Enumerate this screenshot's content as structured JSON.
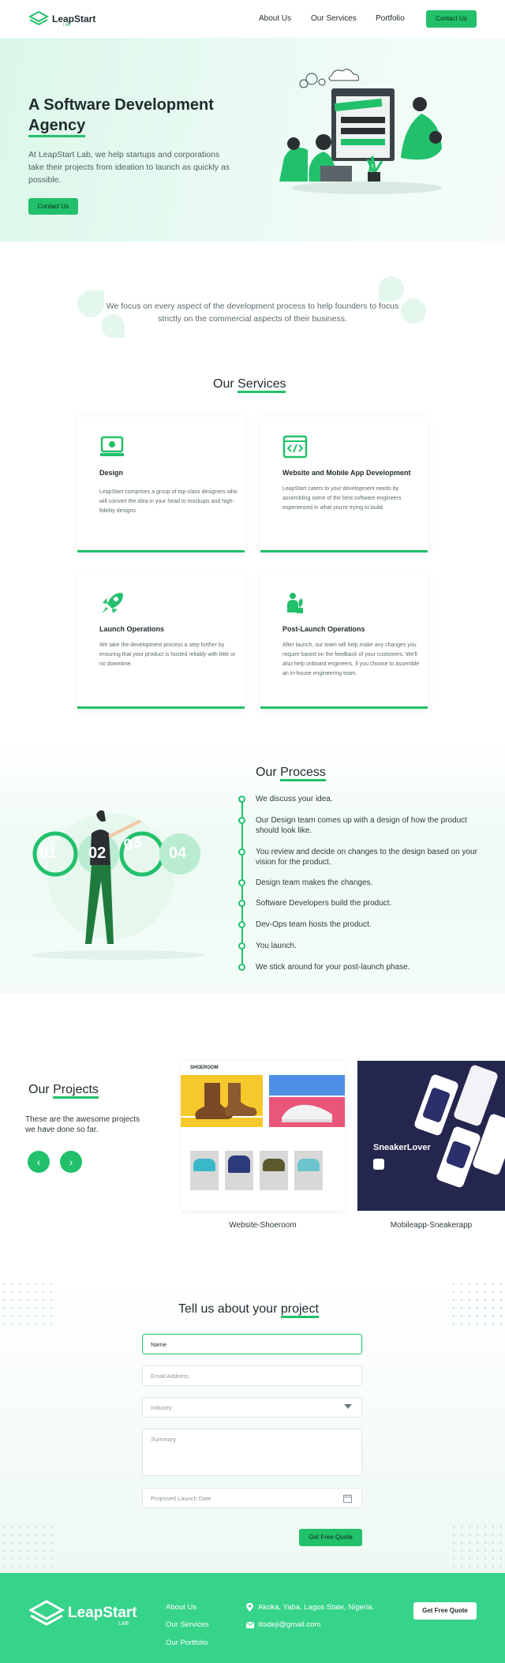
{
  "header": {
    "logo_text": "LeapStart",
    "logo_sub": "LAB",
    "nav": [
      "About Us",
      "Our Services",
      "Portfolio"
    ],
    "cta": "Contact Us"
  },
  "hero": {
    "title_line1": "A Software Development",
    "title_line2": "Agency",
    "subtitle": "At LeapStart Lab, we help startups and corporations take their projects from ideation to launch as quickly as possible.",
    "cta": "Contact Us"
  },
  "focus": {
    "text": "We focus on every aspect of the development process to help founders to focus strictly on the commercial aspects of their business."
  },
  "services": {
    "title_plain": "Our ",
    "title_accent": "Services",
    "cards": [
      {
        "icon": "laptop-icon",
        "title": "Design",
        "text": "LeapStart comprises a group of top-class designers who will convert the idea in your head to mockups and high-fidelity designs."
      },
      {
        "icon": "code-icon",
        "title": "Website and Mobile App Development",
        "text": "LeapStart caters to your development needs by assembling some of the best software engineers experienced in what you're trying to build."
      },
      {
        "icon": "rocket-icon",
        "title": "Launch Operations",
        "text": "We take the development process a step further by ensuring that your product is hosted reliably with little or no downtime."
      },
      {
        "icon": "person-plant-icon",
        "title": "Post-Launch Operations",
        "text": "After launch, our team will help make any changes you require based on the feedback of your customers. We'll also help onboard engineers, if you choose to assemble an in-house engineering team."
      }
    ]
  },
  "process": {
    "title_plain": "Our ",
    "title_accent": "Process",
    "numbers": [
      "01",
      "02",
      "03",
      "04"
    ],
    "steps": [
      "We discuss your idea.",
      "Our Design team comes up with a design of how the product should look like.",
      "You review and decide on changes to the design based on your vision for the product.",
      "Design team makes the changes.",
      "Software Developers build the product.",
      "Dev-Ops team hosts the product.",
      "You launch.",
      "We stick around for your post-launch phase."
    ]
  },
  "projects": {
    "title_plain": "Our ",
    "title_accent": "Projects",
    "subtitle": "These are the awesome projects we have done so far.",
    "items": [
      {
        "caption": "Website-Shoeroom",
        "brand": "SHOEROOM"
      },
      {
        "caption": "Mobileapp-Sneakerapp",
        "brand": "SneakerLover"
      }
    ]
  },
  "form": {
    "title_plain": "Tell us about your ",
    "title_accent": "project",
    "name_placeholder": "Name",
    "email_placeholder": "Email Address",
    "industry_placeholder": "Industry",
    "summary_placeholder": "Summary",
    "date_placeholder": "Proposed Launch Date",
    "submit": "Get Free Quote"
  },
  "footer": {
    "logo_text": "LeapStart",
    "logo_sub": "LAB",
    "links": [
      "About Us",
      "Our Services",
      "Our Portfolio"
    ],
    "address": "Akoka, Yaba, Lagos State, Nigeria.",
    "email": "itisdeji@gmail.com",
    "cta": "Get Free Quote"
  },
  "colors": {
    "accent": "#22c06b",
    "footer": "#36d38a",
    "dark": "#1f2a2e"
  }
}
